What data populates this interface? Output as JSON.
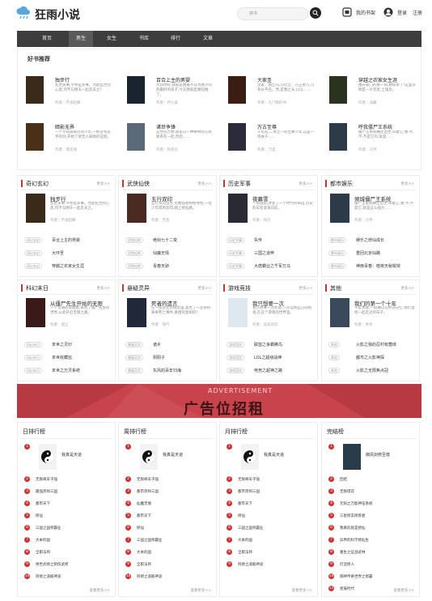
{
  "header": {
    "logo": "狂雨小说",
    "search_placeholder": "搜书",
    "my_shelf": "我的书架",
    "login": "登录",
    "register": "注册"
  },
  "nav": [
    "首页",
    "男生",
    "女生",
    "书库",
    "排行",
    "文章"
  ],
  "recommend": {
    "title": "好书推荐",
    "books": [
      {
        "title": "独步行",
        "desc": "乱世多事,今亦是多事。为此乱世兜心底,何不与明天一起走去之?",
        "author": "作者：不会起舞",
        "cover": "#3a2a1a"
      },
      {
        "title": "百合上主的男婴",
        "desc": "大叔你好,我就是她最不以为地学问的最好的孩子,今天我就是要陪她了。",
        "author": "作者：乔九安",
        "cover": "#1a2430"
      },
      {
        "title": "大家圣",
        "desc": "出家：我乞巧,乃比丘：乃王者乃,乃有长平名。然,是我之长,以父……",
        "author": "作者：九门哪的书",
        "cover": "#3b1d14"
      },
      {
        "title": "穿越之农家女生涯",
        "desc": "推开家门的那一刻,她惊呆了!这里分明是一片荒芜,土墙房。",
        "author": "作者：浅藏",
        "cover": "#2a3320"
      },
      {
        "title": "暗影无界",
        "desc": "一个不知道来历的少年,一把没有名字的剑,开始了他无人知晓的征程。",
        "author": "作者：落花城",
        "cover": "#4a3018"
      },
      {
        "title": "诸世争锋",
        "desc": "这世间万物,总是以一种奇特的方式联系在一起,然后……",
        "author": "作者：风卷云",
        "cover": "#5a6a78"
      },
      {
        "title": "万古至尊",
        "desc": "千年前,二零之一的至尊少年,这是一场关于……",
        "author": "作者：刀圣",
        "cover": "#2b2b3b"
      },
      {
        "title": "呼我僵尸王系统",
        "desc": "僵尸王系统横空出世,带着它,我:不,不,不是它的,就是……",
        "author": "作者：冷月",
        "cover": "#2d3a48"
      }
    ]
  },
  "cats": [
    {
      "name": "奇幻玄幻",
      "more": "更多>>",
      "book": "独步行",
      "desc": "乱世多事,今亦是多事。为此乱世兜心底,何不与明天一起走去之。",
      "author": "作者：不会起舞",
      "cover": "#3a2a1a",
      "list": [
        [
          "奇幻玄幻",
          "百合上主的男婴"
        ],
        [
          "奇幻玄幻",
          "大环圣"
        ],
        [
          "奇幻玄幻",
          "穿越之农家女生涯"
        ]
      ]
    },
    {
      "name": "武侠仙侠",
      "more": "更多>>",
      "book": "五行双印",
      "desc": "五行双印出世,无数强者纷纷寻找,一位少年得到双印,踏上修仙路。",
      "author": "作者：无名",
      "cover": "#4a2a22",
      "list": [
        [
          "武侠仙侠",
          "绝剑七十二变"
        ],
        [
          "武侠仙侠",
          "仙魔无情"
        ],
        [
          "武侠仙侠",
          "青春天骄"
        ]
      ]
    },
    {
      "name": "历史军事",
      "more": "更多>>",
      "book": "夜幕雪",
      "desc": "一场战役,改变了一个时代的命运,历史的车轮滚滚向前。",
      "author": "作者：四方",
      "cover": "#2a2a35",
      "list": [
        [
          "历史军事",
          "失传"
        ],
        [
          "历史军事",
          "三国之道奔"
        ],
        [
          "历史军事",
          "大唐霸业之千军万马"
        ]
      ]
    },
    {
      "name": "都市娱乐",
      "more": "更多>>",
      "book": "倾城僵尸王系统",
      "desc": "僵尸王系统横空出世,带着它,我:不,不是它,就是这么强大……",
      "author": "作者：冷月",
      "cover": "#2d3a48",
      "list": [
        [
          "都市娱乐",
          "娱乐之修仙成长"
        ],
        [
          "都市娱乐",
          "重回北京仙路"
        ],
        [
          "都市娱乐",
          "神雨青春：暗夜天秘锐突"
        ]
      ]
    },
    {
      "name": "科幻末日",
      "more": "更多>>",
      "book": "从僵尸先生开始的无限",
      "desc": "一个普通的穿越者,来到了僵尸先生的世界,从此开启无限之路。",
      "author": "作者：道尘",
      "cover": "#3a1a18",
      "list": [
        [
          "科幻末日",
          "末世之灵印"
        ],
        [
          "科幻末日",
          "末世收藏狂"
        ],
        [
          "科幻末日",
          "末世之万灵系统"
        ]
      ]
    },
    {
      "name": "悬疑灵异",
      "more": "更多>>",
      "book": "死者的遗言",
      "desc": "在一座古老的城堡里,发生了一连串的离奇死亡事件,真相究竟如何?",
      "author": "作者：夜行",
      "cover": "#20283a",
      "list": [
        [
          "悬疑灵异",
          "诡乡"
        ],
        [
          "悬疑灵异",
          "阴阳子"
        ],
        [
          "悬疑灵异",
          "东风的百年归海"
        ]
      ]
    },
    {
      "name": "游戏竞技",
      "more": "更多>>",
      "book": "我只想要一次",
      "desc": "我只想要一次机会,一次证明自己的机会,在这个游戏的世界里。",
      "author": "作者：竞技风云",
      "cover": "#dfe7ef",
      "list": [
        [
          "游戏竞技",
          "联盟之争霸腾鸟"
        ],
        [
          "游戏竞技",
          "LOL之超级战神"
        ],
        [
          "游戏竞技",
          "电竞之超神之路"
        ]
      ]
    },
    {
      "name": "其他",
      "more": "更多>>",
      "book": "我们的第一个十年",
      "desc": "十年青春,一段难以忘怀的记忆,我们曾经一起走过的日子。",
      "author": "作者：青木",
      "cover": "#3a4a5a",
      "list": [
        [
          "其他",
          "火影之我的忍村有菌体"
        ],
        [
          "其他",
          "都市之火影神探"
        ],
        [
          "其他",
          "火影之无限焦点冠"
        ]
      ]
    }
  ],
  "ad": {
    "line1": "ADVERTISEMENT",
    "line2": "广告位招租"
  },
  "ranks": [
    {
      "title": "日排行榜",
      "top": "我真是天道",
      "items": [
        "无限奇军子强",
        "最强宗师三国",
        "都市天下",
        "修仙",
        "三国之国师霸业",
        "大本的国",
        "全职法师",
        "绝世武修之刺伤武修",
        "阿修之道殿神途"
      ],
      "more": "查看更多>>"
    },
    {
      "title": "周排行榜",
      "top": "我真是天道",
      "items": [
        "无限奇军子强",
        "都市宗师三国",
        "仙魔无情",
        "都市天下",
        "修仙",
        "三国之国师霸业",
        "大本的国",
        "全职法师",
        "阿修之道殿神途"
      ],
      "more": "查看更多>>"
    },
    {
      "title": "月排行榜",
      "top": "我真是天道",
      "items": [
        "无限奇军子强",
        "都市宗师三国",
        "都市天下",
        "修仙",
        "三国之国师霸业",
        "大本的国",
        "全职法师",
        "阿修之道殿神途"
      ],
      "more": "查看更多>>"
    },
    {
      "title": "完结榜",
      "top": "御风剑修至尊",
      "items": [
        "回结",
        "无限得花",
        "元阳之万能神伍系统",
        "三星修玄修炼者",
        "我真的就是修仙",
        "异界的科学修仙生",
        "重生之征战武林",
        "打造修人",
        "御神传奇世界之修霸",
        "星辰时代"
      ],
      "more": "查看更多>>"
    }
  ],
  "colors": {
    "accent": "#cc3333",
    "nav": "#3d3d3d",
    "ad": "#c8434c"
  }
}
